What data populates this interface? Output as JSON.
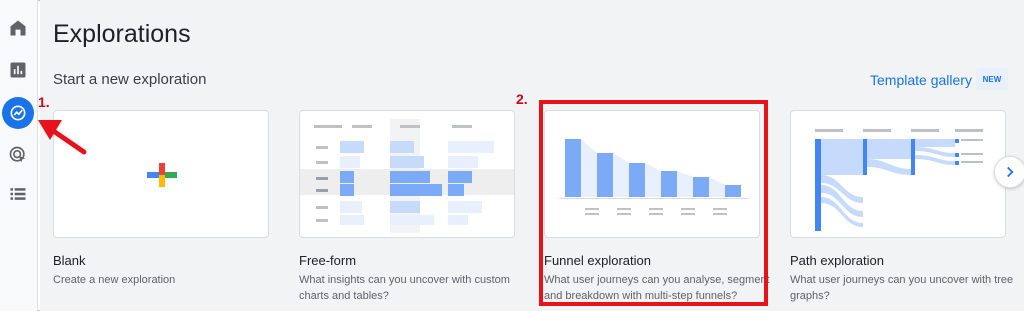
{
  "page": {
    "title": "Explorations",
    "subtitle": "Start a new exploration",
    "template_gallery_label": "Template gallery",
    "new_badge": "NEW"
  },
  "rail": {
    "icons": [
      "home-icon",
      "reports-icon",
      "explore-icon",
      "advertising-icon",
      "list-icon"
    ],
    "active": "explore-icon",
    "accent": "#1a73e8"
  },
  "cards": [
    {
      "title": "Blank",
      "desc": "Create a new exploration"
    },
    {
      "title": "Free-form",
      "desc": "What insights can you uncover with custom charts and tables?"
    },
    {
      "title": "Funnel exploration",
      "desc": "What user journeys can you analyse, segment and breakdown with multi-step funnels?"
    },
    {
      "title": "Path exploration",
      "desc": "What user journeys can you uncover with tree graphs?"
    }
  ],
  "annotations": {
    "step1": "1.",
    "step2": "2.",
    "color": "#e8121a"
  }
}
